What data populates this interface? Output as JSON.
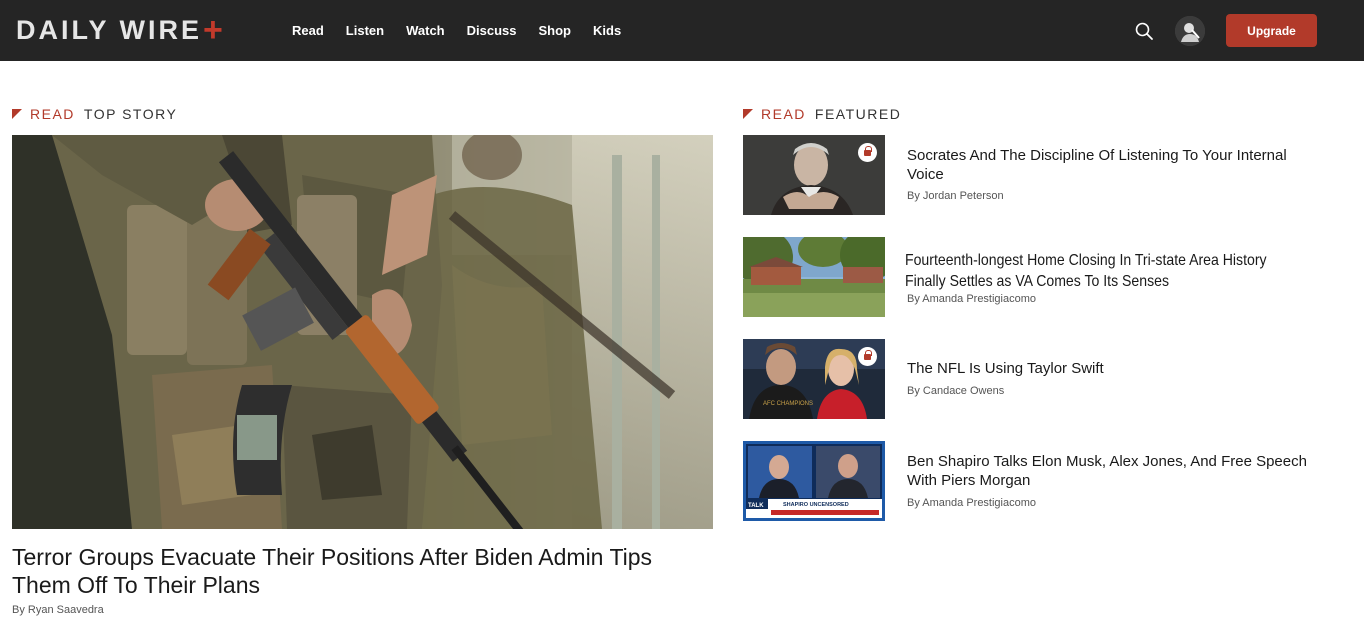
{
  "header": {
    "logo_text": "DAILY WIRE",
    "logo_plus": "+",
    "nav": [
      "Read",
      "Listen",
      "Watch",
      "Discuss",
      "Shop",
      "Kids"
    ],
    "upgrade_label": "Upgrade"
  },
  "top_story": {
    "section_read": "READ",
    "section_name": "TOP STORY",
    "title": "Terror Groups Evacuate Their Positions After Biden Admin Tips Them Off To Their Plans",
    "byline": "By Ryan Saavedra"
  },
  "featured": {
    "section_read": "READ",
    "section_name": "FEATURED",
    "items": [
      {
        "title": "Socrates And The Discipline Of Listening To Your Internal Voice",
        "byline": "By Jordan Peterson"
      },
      {
        "title": "Fourteenth-longest Home Closing In Tri-state Area History Finally Settles as VA Comes To Its Senses",
        "byline": "By Amanda Prestigiacomo"
      },
      {
        "title": "The NFL Is Using Taylor Swift",
        "byline": "By Candace Owens"
      },
      {
        "title": "Ben Shapiro Talks Elon Musk, Alex Jones, And Free Speech With Piers Morgan",
        "byline": "By Amanda Prestigiacomo"
      }
    ]
  },
  "thumb_text": {
    "chiefs_shirt": "AFC CHAMPIONS",
    "tv_banner": "SHAPIRO UNCENSORED",
    "tv_logo": "TALK"
  },
  "colors": {
    "accent": "#b23a2a",
    "topbar": "#252525"
  },
  "icons": [
    "search-icon",
    "account-icon",
    "premium-lock-icon"
  ]
}
